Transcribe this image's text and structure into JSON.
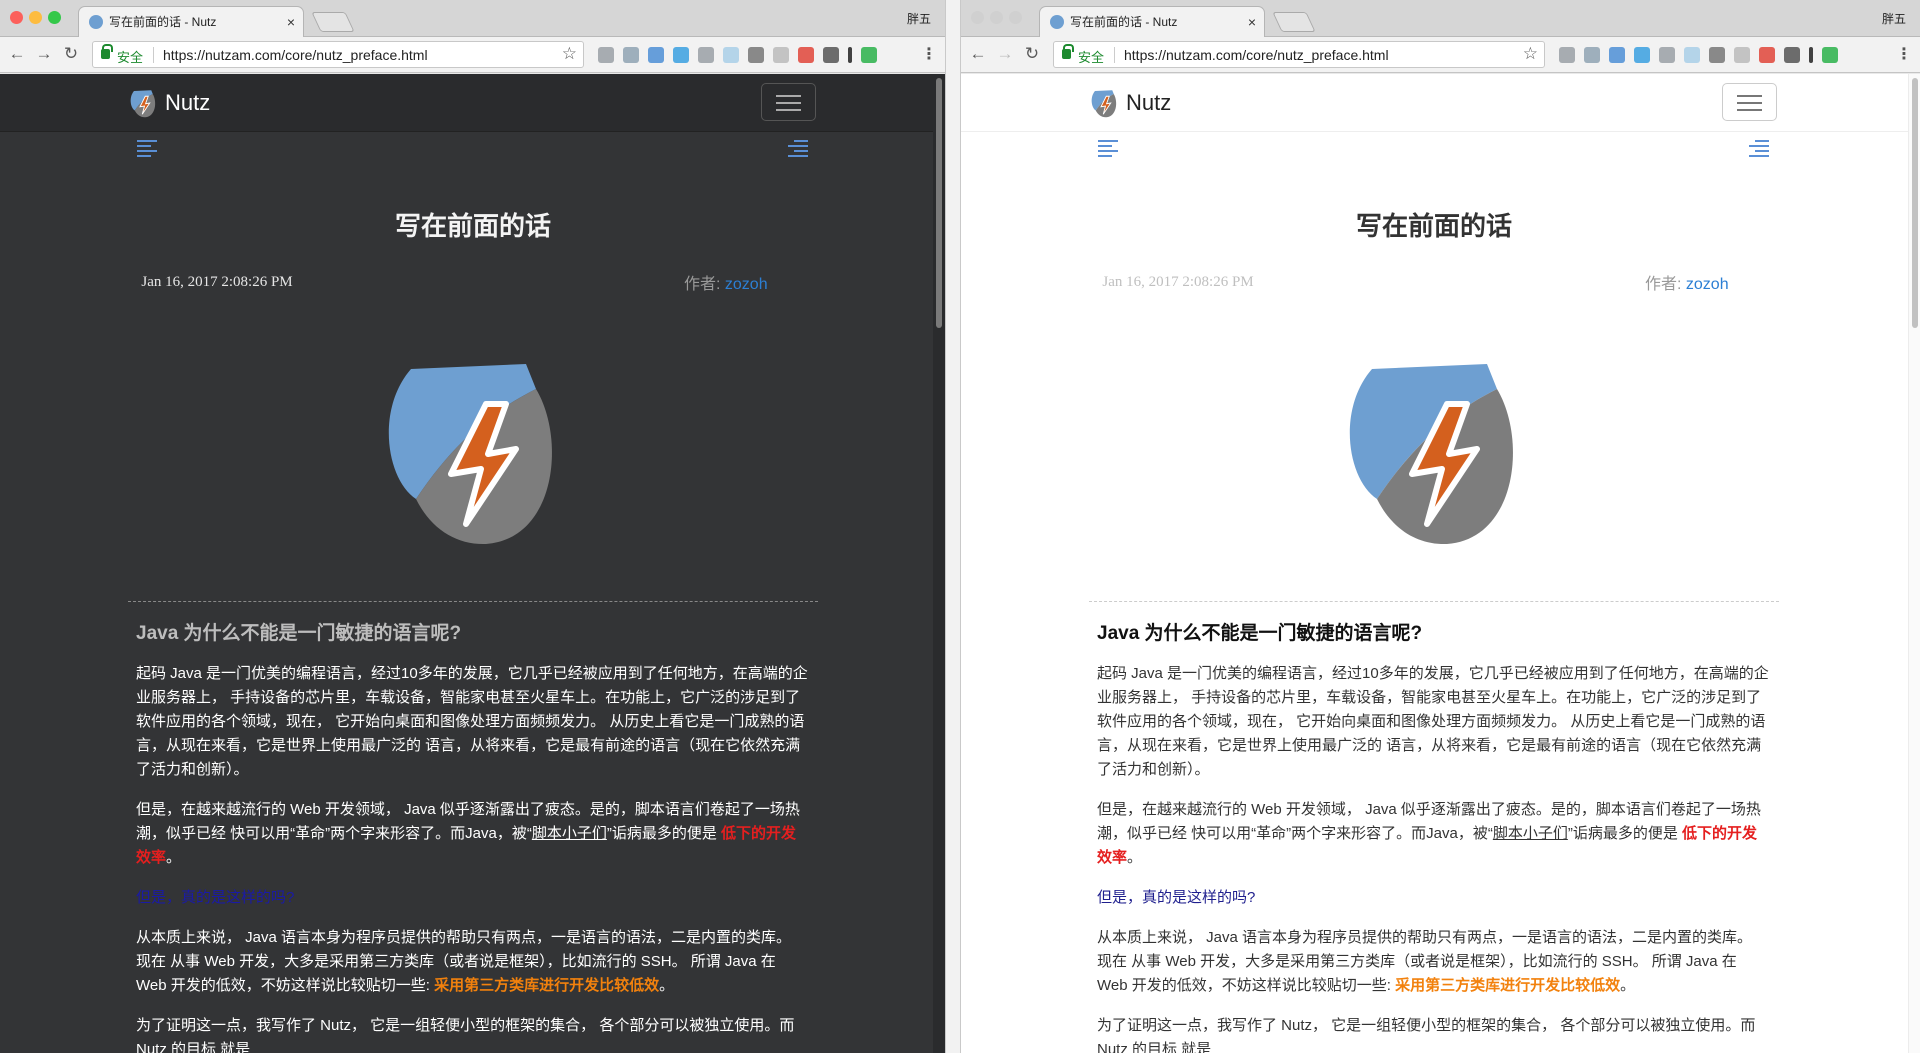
{
  "tab": {
    "title": "写在前面的话 - Nutz",
    "close": "×"
  },
  "user": "胖五",
  "omnibox": {
    "secure_label": "安全",
    "url": "https://nutzam.com/core/nutz_preface.html"
  },
  "site": {
    "brand": "Nutz"
  },
  "article": {
    "title": "写在前面的话",
    "date": "Jan 16, 2017 2:08:26 PM",
    "author_label": "作者:",
    "author": "zozoh",
    "heading": "Java 为什么不能是一门敏捷的语言呢?",
    "p1": "起码 Java 是一门优美的编程语言，经过10多年的发展，它几乎已经被应用到了任何地方，在高端的企业服务器上， 手持设备的芯片里，车载设备，智能家电甚至火星车上。在功能上，它广泛的涉足到了软件应用的各个领域，现在， 它开始向桌面和图像处理方面频频发力。 从历史上看它是一门成熟的语言，从现在来看，它是世界上使用最广泛的 语言，从将来看，它是最有前途的语言（现在它依然充满了活力和创新）。",
    "p2_a": "但是，在越来越流行的 Web 开发领域， Java 似乎逐渐露出了疲态。是的，脚本语言们卷起了一场热潮，似乎已经 快可以用“革命”两个字来形容了。而Java，被“",
    "p2_link": "脚本小子们",
    "p2_b": "”诟病最多的便是 ",
    "p2_red": "低下的开发效率",
    "p2_c": "。",
    "p3": "但是，真的是这样的吗?",
    "p4_a": "从本质上来说， Java 语言本身为程序员提供的帮助只有两点，一是语言的语法，二是内置的类库。 现在 从事 Web 开发，大多是采用第三方类库（或者说是框架），比如流行的 SSH。 所谓 Java 在 Web 开发的低效，不妨这样说比较贴切一些: ",
    "p4_orange": "采用第三方类库进行开发比较低效",
    "p4_b": "。",
    "p5": "为了证明这一点，我写作了 Nutz， 它是一组轻便小型的框架的集合， 各个部分可以被独立使用。而 Nutz 的目标 就是"
  },
  "colors": {
    "accent": "#2c7fd4",
    "red": "#e51f1f",
    "orange": "#f2810d",
    "dark_bg": "#333436",
    "logo_blue": "#6e9fd1",
    "logo_gray": "#7d7d7d",
    "logo_orange": "#d4601e"
  }
}
